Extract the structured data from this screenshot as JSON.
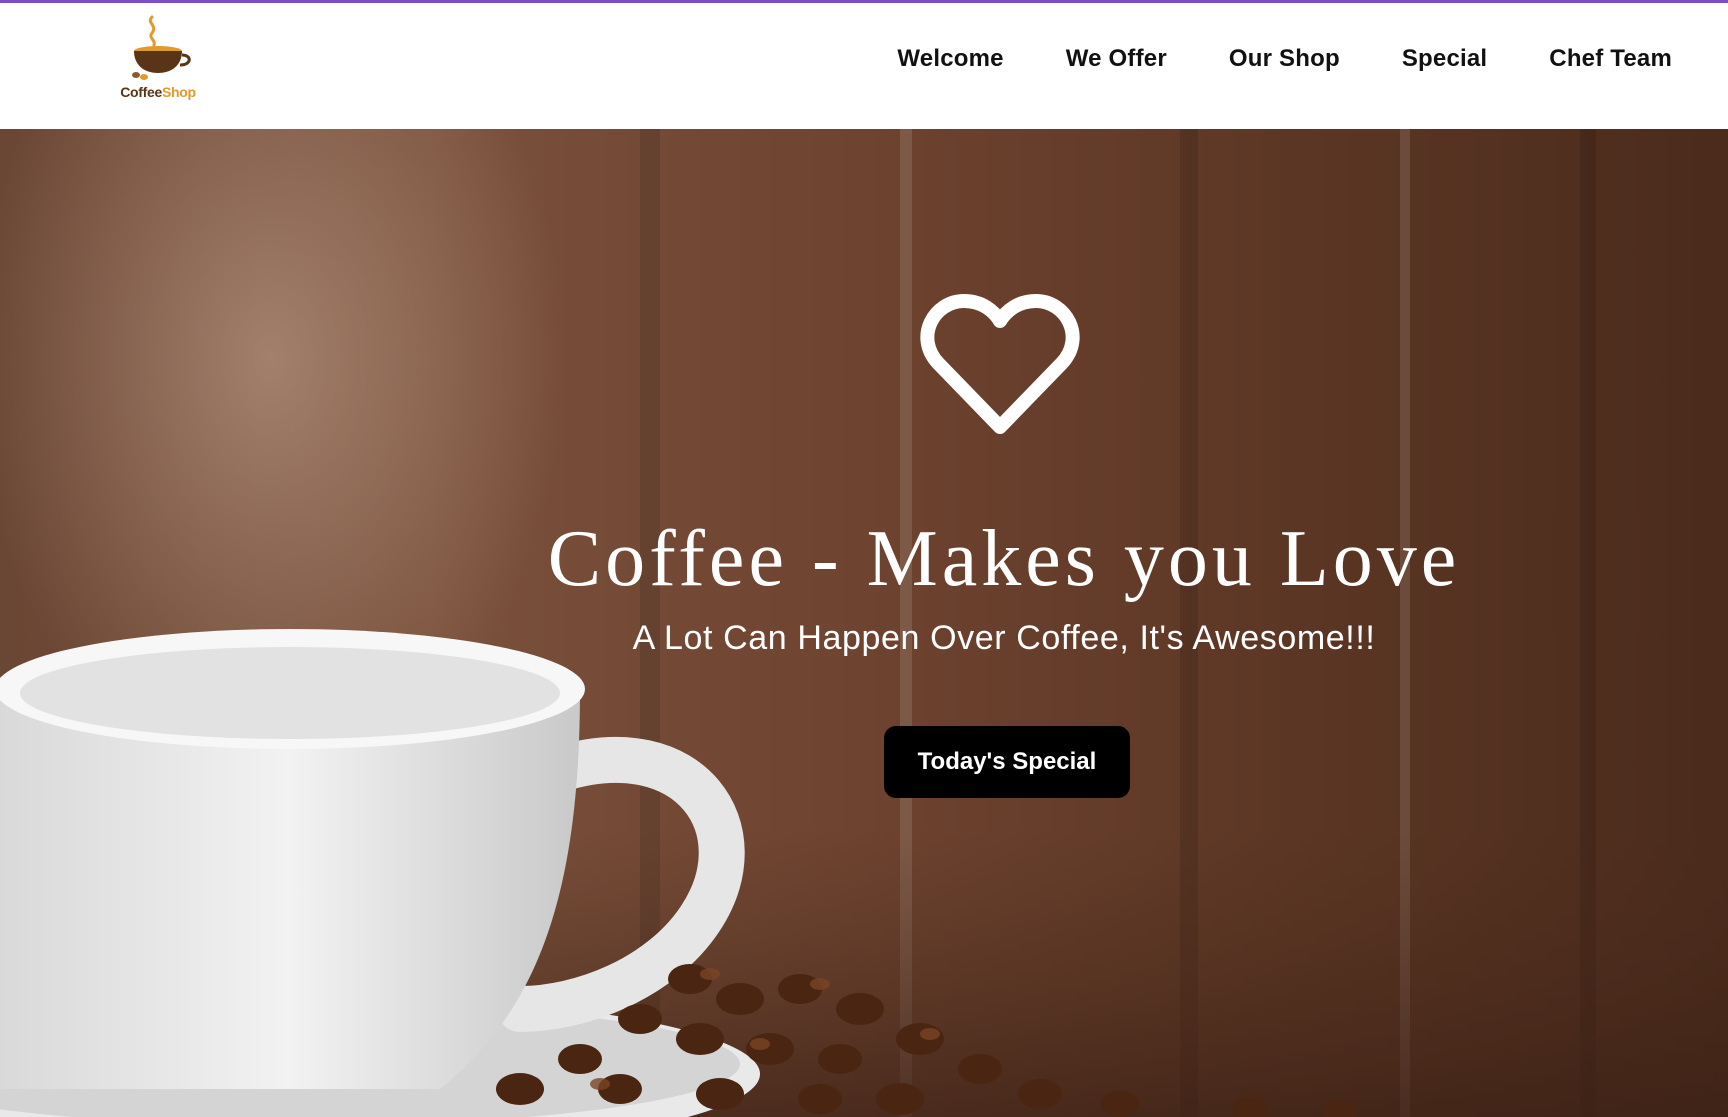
{
  "logo": {
    "text_part1": "Coffee",
    "text_part2": "Shop",
    "icon": "coffee-cup-icon"
  },
  "nav": {
    "items": [
      "Welcome",
      "We Offer",
      "Our Shop",
      "Special",
      "Chef Team"
    ]
  },
  "hero": {
    "icon": "heart-icon",
    "title": "Coffee - Makes you Love",
    "subtitle": "A Lot Can Happen Over Coffee, It's Awesome!!!",
    "button_label": "Today's Special",
    "image": "coffee-cup-and-beans-image"
  },
  "colors": {
    "top_line": "#7a4fc9",
    "logo_brown": "#5a3416",
    "logo_orange": "#e19a2b",
    "button_bg": "#000000"
  }
}
